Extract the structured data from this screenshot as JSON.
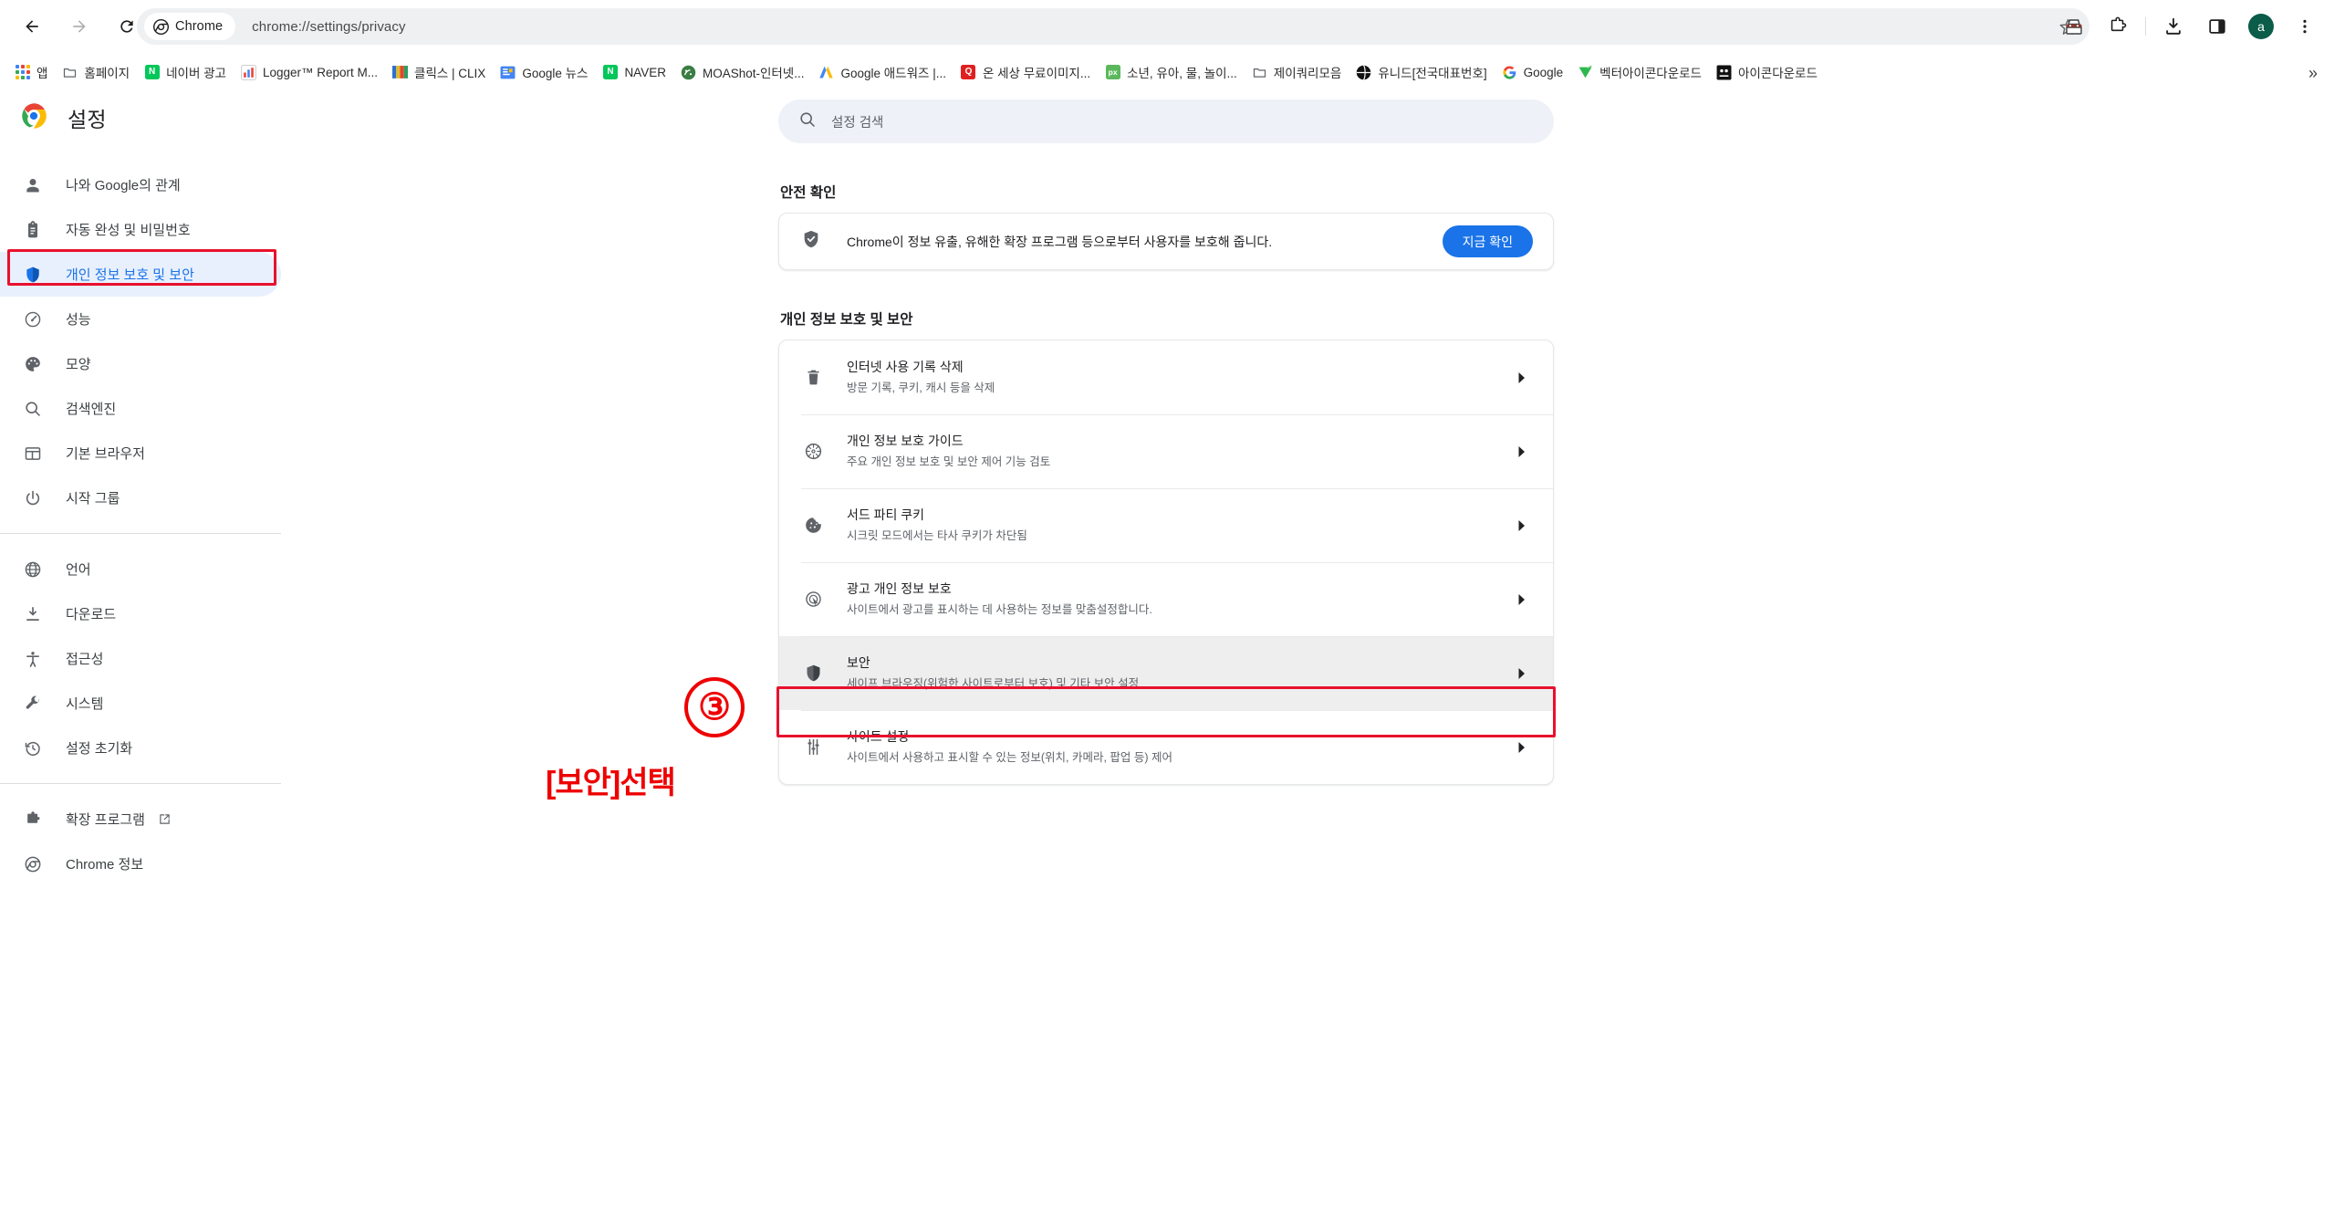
{
  "browser": {
    "nav": {
      "back": "back-arrow",
      "forward": "forward-arrow",
      "reload": "reload"
    },
    "omnibox": {
      "chip_label": "Chrome",
      "url": "chrome://settings/privacy"
    },
    "toolbar_right": {
      "avatar_letter": "a"
    },
    "bookmarks": [
      {
        "label": "앱",
        "icon": "apps-grid",
        "color": ""
      },
      {
        "label": "홈페이지",
        "icon": "folder",
        "color": ""
      },
      {
        "label": "네이버 광고",
        "icon": "letter",
        "glyph": "N",
        "color": "#03c75a"
      },
      {
        "label": "Logger™ Report M...",
        "icon": "chart",
        "color": "#ffffff"
      },
      {
        "label": "클릭스 | CLIX",
        "icon": "stripes",
        "color": ""
      },
      {
        "label": "Google 뉴스",
        "icon": "letter",
        "glyph": "GE",
        "color": "#4285f4"
      },
      {
        "label": "NAVER",
        "icon": "letter",
        "glyph": "N",
        "color": "#03c75a"
      },
      {
        "label": "MOAShot-인터넷...",
        "icon": "circle",
        "color": "#3a7d44"
      },
      {
        "label": "Google 애드워즈 |...",
        "icon": "adwords",
        "color": ""
      },
      {
        "label": "온 세상 무료이미지...",
        "icon": "letter",
        "glyph": "Q",
        "color": "#e02020"
      },
      {
        "label": "소년, 유아, 물, 놀이...",
        "icon": "letter",
        "glyph": "px",
        "color": "#5cb85c"
      },
      {
        "label": "제이쿼리모음",
        "icon": "folder",
        "color": ""
      },
      {
        "label": "유니드[전국대표번호]",
        "icon": "globe-black",
        "color": "#111111"
      },
      {
        "label": "Google",
        "icon": "google-g",
        "color": ""
      },
      {
        "label": "벡터아이콘다운로드",
        "icon": "vector-v",
        "color": "#2db84d"
      },
      {
        "label": "아이콘다운로드",
        "icon": "letter",
        "glyph": "xo",
        "color": "#111111"
      }
    ],
    "overflow_label": "»"
  },
  "settings": {
    "brand_title": "설정",
    "nav_items": [
      {
        "label": "나와 Google의 관계",
        "icon": "person-icon",
        "selected": false,
        "external": false
      },
      {
        "label": "자동 완성 및 비밀번호",
        "icon": "clipboard-icon",
        "selected": false,
        "external": false
      },
      {
        "label": "개인 정보 보호 및 보안",
        "icon": "shield-icon",
        "selected": true,
        "external": false
      },
      {
        "label": "성능",
        "icon": "speedometer-icon",
        "selected": false,
        "external": false
      },
      {
        "label": "모양",
        "icon": "palette-icon",
        "selected": false,
        "external": false
      },
      {
        "label": "검색엔진",
        "icon": "search-icon",
        "selected": false,
        "external": false
      },
      {
        "label": "기본 브라우저",
        "icon": "browser-window-icon",
        "selected": false,
        "external": false
      },
      {
        "label": "시작 그룹",
        "icon": "power-icon",
        "selected": false,
        "external": false
      }
    ],
    "nav_items_2": [
      {
        "label": "언어",
        "icon": "globe-icon",
        "selected": false,
        "external": false
      },
      {
        "label": "다운로드",
        "icon": "download-icon",
        "selected": false,
        "external": false
      },
      {
        "label": "접근성",
        "icon": "accessibility-icon",
        "selected": false,
        "external": false
      },
      {
        "label": "시스템",
        "icon": "wrench-icon",
        "selected": false,
        "external": false
      },
      {
        "label": "설정 초기화",
        "icon": "restore-icon",
        "selected": false,
        "external": false
      }
    ],
    "nav_items_3": [
      {
        "label": "확장 프로그램",
        "icon": "puzzle-icon",
        "selected": false,
        "external": true
      },
      {
        "label": "Chrome 정보",
        "icon": "chrome-icon",
        "selected": false,
        "external": false
      }
    ],
    "search": {
      "placeholder": "설정 검색"
    },
    "safety_check": {
      "heading": "안전 확인",
      "message": "Chrome이 정보 유출, 유해한 확장 프로그램 등으로부터 사용자를 보호해 줍니다.",
      "button": "지금 확인"
    },
    "privacy_section": {
      "heading": "개인 정보 보호 및 보안",
      "rows": [
        {
          "title": "인터넷 사용 기록 삭제",
          "sub": "방문 기록, 쿠키, 캐시 등을 삭제",
          "icon": "trash-icon",
          "selected": false
        },
        {
          "title": "개인 정보 보호 가이드",
          "sub": "주요 개인 정보 보호 및 보안 제어 기능 검토",
          "icon": "compass-icon",
          "selected": false
        },
        {
          "title": "서드 파티 쿠키",
          "sub": "시크릿 모드에서는 타사 쿠키가 차단됨",
          "icon": "cookie-icon",
          "selected": false
        },
        {
          "title": "광고 개인 정보 보호",
          "sub": "사이트에서 광고를 표시하는 데 사용하는 정보를 맞춤설정합니다.",
          "icon": "ad-privacy-icon",
          "selected": false
        },
        {
          "title": "보안",
          "sub": "세이프 브라우징(위험한 사이트로부터 보호) 및 기타 보안 설정",
          "icon": "shield-icon",
          "selected": true
        },
        {
          "title": "사이트 설정",
          "sub": "사이트에서 사용하고 표시할 수 있는 정보(위치, 카메라, 팝업 등) 제어",
          "icon": "sliders-icon",
          "selected": false
        }
      ]
    }
  },
  "annotation": {
    "step_number": "③",
    "caption": "[보안]선택",
    "color": "#ef0000"
  }
}
